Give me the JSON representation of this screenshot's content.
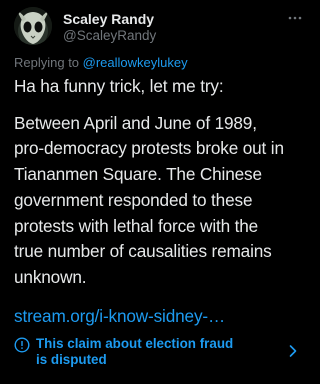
{
  "author": {
    "display_name": "Scaley Randy",
    "handle": "@ScaleyRandy",
    "avatar_icon": "alien-avatar-icon"
  },
  "menu": {
    "icon": "more-horizontal-icon"
  },
  "reply_context": {
    "prefix": "Replying to ",
    "mention": "@reallowkeylukey"
  },
  "tweet": {
    "intro": "Ha ha funny trick, let me try:",
    "lines": [
      "Between April and June of 1989,",
      "pro-democracy protests broke out in",
      "Tiananmen Square. The Chinese",
      "government responded to these",
      "protests with lethal force with the",
      "true number of causalities remains",
      "unknown."
    ],
    "link_text": "stream.org/i-know-sidney-…"
  },
  "notice": {
    "icon": "info-circle-icon",
    "line1": "This claim about election fraud",
    "line2": "is disputed",
    "chevron_icon": "chevron-right-icon"
  },
  "colors": {
    "background": "#000000",
    "text_primary": "#e7e9ea",
    "text_secondary": "#71767b",
    "accent": "#1d9bf0"
  }
}
